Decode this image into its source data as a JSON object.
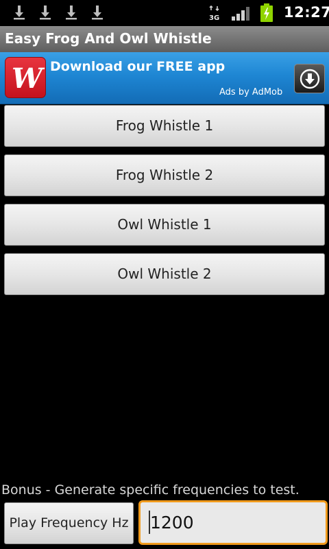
{
  "status_bar": {
    "notification_icons": [
      "download-icon",
      "download-icon",
      "download-icon",
      "download-icon"
    ],
    "network_label": "3G",
    "time": "12:27"
  },
  "app": {
    "title": "Easy Frog And Owl Whistle"
  },
  "ad": {
    "headline": "Download our FREE app",
    "attribution": "Ads by AdMob",
    "logo_icon": "walgreens-w-logo",
    "action_icon": "download-circle-icon"
  },
  "buttons": {
    "frog1": "Frog Whistle 1",
    "frog2": "Frog Whistle 2",
    "owl1": "Owl Whistle 1",
    "owl2": "Owl Whistle 2"
  },
  "bonus": {
    "label": "Bonus - Generate specific frequencies to test.",
    "play_label": "Play Frequency Hz",
    "frequency_value": "1200"
  },
  "colors": {
    "focus_border": "#f09a1c",
    "ad_blue": "#1e86d3",
    "battery_green": "#8fd400"
  }
}
